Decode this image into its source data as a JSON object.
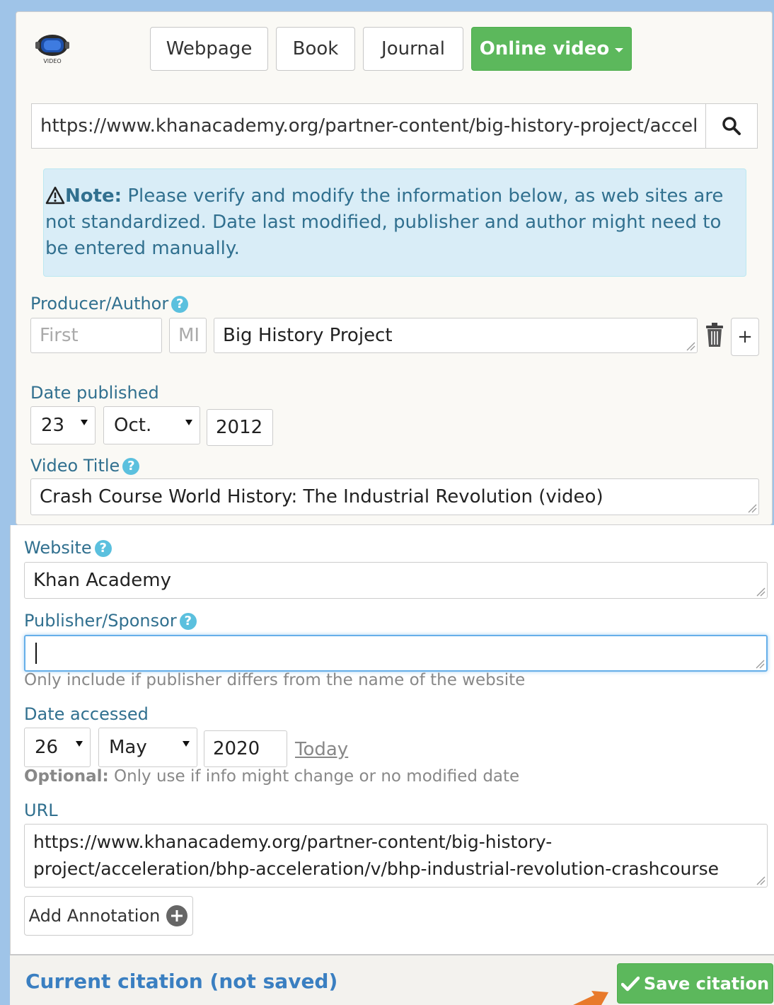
{
  "source_tabs": [
    {
      "label": "Webpage",
      "active": false
    },
    {
      "label": "Book",
      "active": false
    },
    {
      "label": "Journal",
      "active": false
    },
    {
      "label": "Online video",
      "active": true
    }
  ],
  "search": {
    "value": "https://www.khanacademy.org/partner-content/big-history-project/accel"
  },
  "note": {
    "title": "Note:",
    "text": "Please verify and modify the information below, as web sites are not standardized. Date last modified, publisher and author might need to be entered manually."
  },
  "author": {
    "label": "Producer/Author",
    "first_placeholder": "First",
    "mi_placeholder": "MI",
    "last_value": "Big History Project",
    "add_label": "+"
  },
  "date_published": {
    "label": "Date published",
    "day": "23",
    "month": "Oct.",
    "year": "2012"
  },
  "video_title": {
    "label": "Video Title",
    "value": "Crash Course World History: The Industrial Revolution (video)"
  },
  "website": {
    "label": "Website",
    "value": "Khan Academy"
  },
  "publisher": {
    "label": "Publisher/Sponsor",
    "value": "",
    "hint": "Only include if publisher differs from the name of the website"
  },
  "date_accessed": {
    "label": "Date accessed",
    "day": "26",
    "month": "May",
    "year": "2020",
    "today_label": "Today",
    "optional_bold": "Optional:",
    "optional_text": "Only use if info might change or no modified date"
  },
  "url": {
    "label": "URL",
    "line1": "https://www.khanacademy.org/partner-content/big-history-",
    "line2": "project/acceleration/bhp-acceleration/v/bhp-industrial-revolution-crashcourse"
  },
  "annotation": {
    "label": "Add Annotation"
  },
  "footer": {
    "title": "Current citation (not saved)",
    "save_label": "Save citation"
  },
  "colors": {
    "accent_green": "#5cb85c",
    "label_blue": "#31708f",
    "note_bg": "#d9edf7",
    "footer_title": "#3a7fc1",
    "arrow_orange": "#e87a2b"
  }
}
